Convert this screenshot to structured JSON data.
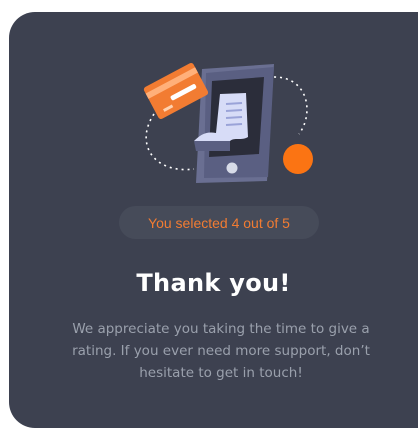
{
  "card": {
    "selection_text": "You selected 4 out of 5",
    "title": "Thank you!",
    "message": "We appreciate you taking the time to give a rating. If you ever need more support, don’t hesitate to get in touch!",
    "rating_selected": 4,
    "rating_max": 5
  },
  "colors": {
    "background": "#ffffff",
    "card": "#3d4150",
    "pill": "#464b59",
    "accent": "#f27c32",
    "title": "#ffffff",
    "message": "#9aa0ac"
  },
  "icons": [
    "payment-illustration",
    "phone-icon",
    "credit-card-icon",
    "receipt-icon",
    "orange-dot-icon"
  ]
}
